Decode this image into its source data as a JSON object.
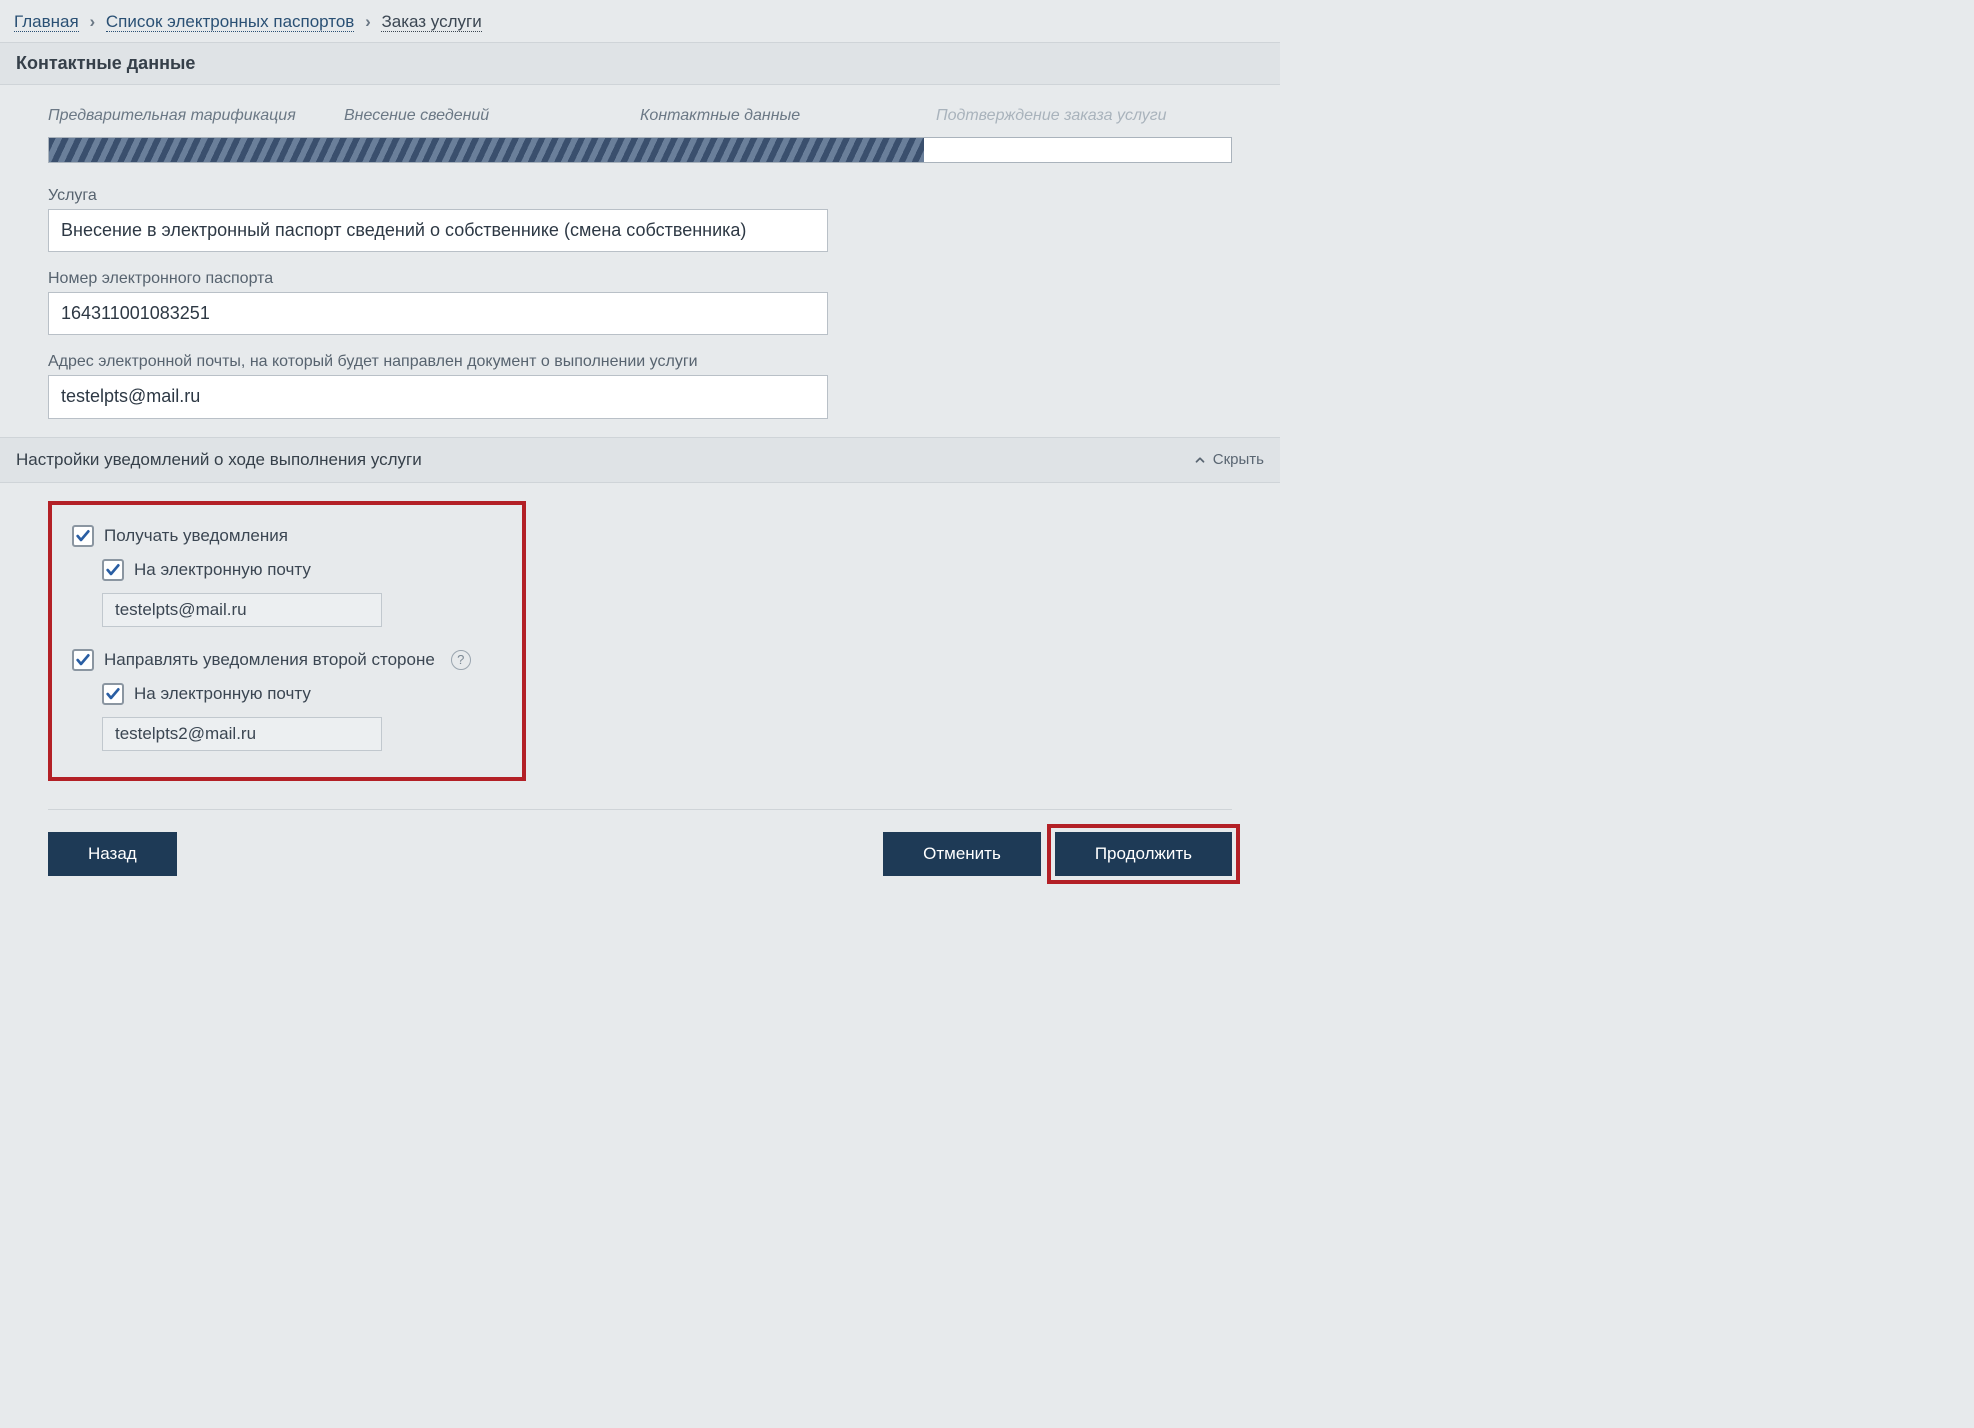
{
  "breadcrumb": {
    "home": "Главная",
    "list": "Список электронных паспортов",
    "current": "Заказ услуги"
  },
  "section_title": "Контактные данные",
  "wizard": {
    "step1": "Предварительная тарификация",
    "step2": "Внесение сведений",
    "step3": "Контактные данные",
    "step4": "Подтверждение заказа услуги"
  },
  "service": {
    "label": "Услуга",
    "value": "Внесение в электронный паспорт сведений о собственнике (смена собственника)"
  },
  "passport": {
    "label": "Номер электронного паспорта",
    "value": "164311001083251"
  },
  "email": {
    "label": "Адрес электронной почты, на который будет направлен документ о выполнении услуги",
    "value": "testelpts@mail.ru"
  },
  "notifications": {
    "header": "Настройки уведомлений о ходе выполнения услуги",
    "toggle": "Скрыть",
    "receive_label": "Получать уведомления",
    "by_email_label": "На электронную почту",
    "email1": "testelpts@mail.ru",
    "send_other_label": "Направлять уведомления второй стороне",
    "email2": "testelpts2@mail.ru"
  },
  "buttons": {
    "back": "Назад",
    "cancel": "Отменить",
    "continue": "Продолжить"
  }
}
